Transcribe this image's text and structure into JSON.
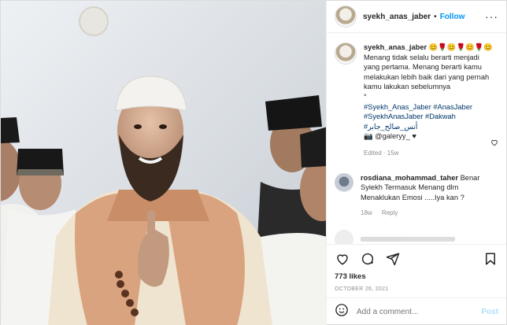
{
  "header": {
    "username": "syekh_anas_jaber",
    "separator": "•",
    "follow_label": "Follow",
    "more_label": "···"
  },
  "caption": {
    "username": "syekh_anas_jaber",
    "emojis": "😊🌹😊🌹😊🌹😊",
    "text_lines": [
      "Menang tidak selalu berarti menjadi",
      "yang pertama. Menang berarti kamu",
      "melakukan lebih baik dari yang pernah",
      "kamu lakukan sebelumnya",
      "°"
    ],
    "hashtags_line1": "#Syekh_Anas_Jaber #AnasJaber",
    "hashtags_line2": "#SyekhAnasJaber #Dakwah",
    "hashtags_line3": "#أنس_صالح_جابر",
    "credit": "📷 @galeryy_ ♥",
    "meta": "Edited · 15w"
  },
  "comment": {
    "username": "rosdiana_mohammad_taher",
    "text": "Benar Syiekh Termasuk Menang dlm Menaklukan Emosi .....Iya kan ?",
    "time": "18w",
    "reply_label": "Reply"
  },
  "stats": {
    "likes": "773 likes",
    "date": "OCTOBER 26, 2021"
  },
  "add_comment": {
    "placeholder": "Add a comment...",
    "post_label": "Post"
  },
  "colors": {
    "accent": "#0095f6",
    "hashtag": "#00376b",
    "muted": "#8e8e8e"
  },
  "icons": [
    "heart-icon",
    "comment-icon",
    "share-icon",
    "bookmark-icon",
    "emoji-icon",
    "more-icon"
  ]
}
